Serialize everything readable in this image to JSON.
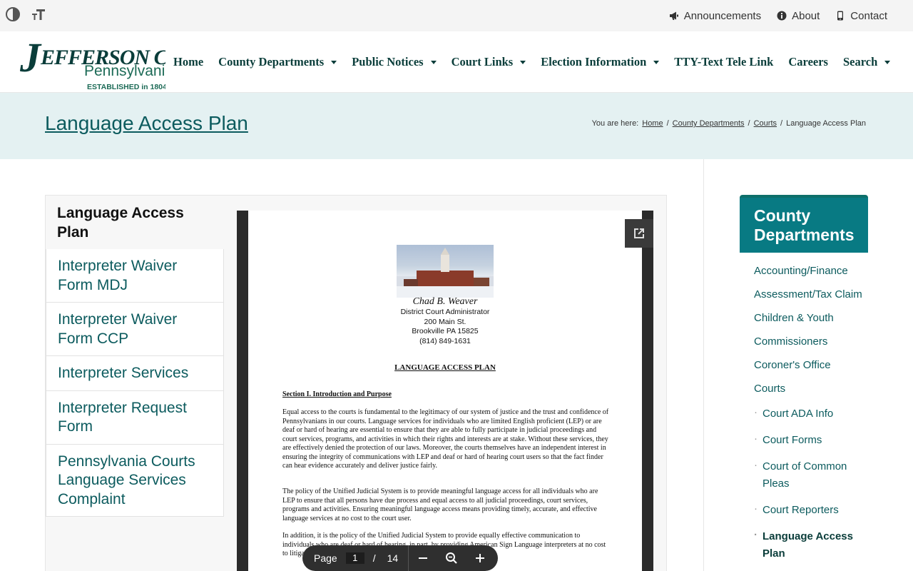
{
  "utility_bar": {
    "contrast_icon": "contrast-icon",
    "text_size_icon": "text-size-icon",
    "links": [
      {
        "label": "Announcements",
        "icon": "megaphone-icon"
      },
      {
        "label": "About",
        "icon": "info-icon"
      },
      {
        "label": "Contact",
        "icon": "phone-icon"
      }
    ]
  },
  "logo": {
    "j": "J",
    "rest": "EFFERSON CO",
    "state": "Pennsylvania",
    "established": "ESTABLISHED in 1804"
  },
  "nav": [
    {
      "label": "Home",
      "dropdown": false
    },
    {
      "label": "County Departments",
      "dropdown": true
    },
    {
      "label": "Public Notices",
      "dropdown": true
    },
    {
      "label": "Court Links",
      "dropdown": true
    },
    {
      "label": "Election Information",
      "dropdown": true
    },
    {
      "label": "TTY-Text Tele Link",
      "dropdown": false
    },
    {
      "label": "Careers",
      "dropdown": false
    },
    {
      "label": "Search",
      "dropdown": true
    }
  ],
  "title_band": {
    "title": "Language Access Plan",
    "breadcrumb_prefix": "You are here:",
    "crumbs": [
      "Home",
      "County Departments",
      "Courts"
    ],
    "current": "Language Access Plan",
    "separator": "/"
  },
  "documents": {
    "items": [
      "Language Access Plan",
      "Interpreter Waiver Form MDJ",
      "Interpreter Waiver Form CCP",
      "Interpreter Services",
      "Interpreter Request Form",
      "Pennsylvania Courts Language Services Complaint"
    ],
    "active_index": 0
  },
  "pdf": {
    "letterhead": {
      "name": "Chad B. Weaver",
      "lines": [
        "District Court Administrator",
        "200 Main St.",
        "Brookville PA 15825",
        "(814) 849-1631"
      ]
    },
    "heading": "LANGUAGE ACCESS PLAN",
    "section": "Section I.  Introduction and Purpose",
    "paragraphs": [
      "Equal access to the courts is fundamental to the legitimacy of our system of justice and the trust and confidence of Pennsylvanians in our courts. Language services for individuals who are limited English proficient (LEP) or are deaf or hard of hearing are essential to ensure that they are able to fully participate in judicial proceedings and court services, programs, and activities in which their rights and interests are at stake. Without these services, they are effectively denied the protection of our laws. Moreover, the courts themselves have an independent interest in ensuring the integrity of communications with LEP and deaf or hard of hearing court users so that the fact finder can hear evidence accurately and deliver justice fairly.",
      "The policy of the Unified Judicial System is to provide meaningful language access for all individuals who are LEP to ensure that all persons have due process and equal access to all judicial proceedings, court services, programs and activities. Ensuring meaningful language access means providing timely, accurate, and effective language services at no cost to the court user.",
      "In addition, it is the policy of the Unified Judicial System to provide equally effective communication to individuals who are deaf or hard of hearing, in part, by providing American Sign Language interpreters at no cost to litigants, witnesses, and court spectators."
    ],
    "toolbar": {
      "page_label": "Page",
      "page_current": "1",
      "page_sep": "/",
      "page_total": "14"
    }
  },
  "sidebar": {
    "heading": "County Departments",
    "items": [
      "Accounting/Finance",
      "Assessment/Tax Claim",
      "Children & Youth",
      "Commissioners",
      "Coroner's Office",
      "Courts"
    ],
    "subitems": [
      "Court ADA Info",
      "Court Forms",
      "Court of Common Pleas",
      "Court Reporters",
      "Language Access Plan"
    ],
    "current_sub_index": 4
  },
  "colors": {
    "brand_dark": "#0a3d3a",
    "link_teal": "#0c5b5e",
    "sidebar_head": "#087a83",
    "title_band_bg": "#e4f1f2"
  }
}
